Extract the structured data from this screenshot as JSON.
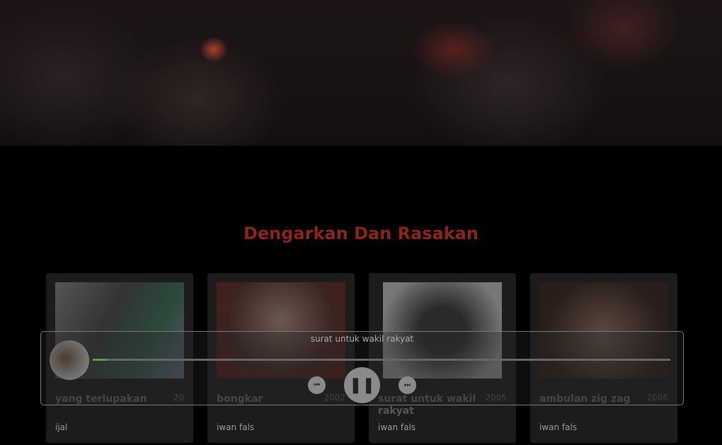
{
  "section_title": "Dengarkan Dan Rasakan",
  "cards": [
    {
      "title": "yang terlupakan",
      "year": "20",
      "artist": "ijal"
    },
    {
      "title": "bongkar",
      "year": "2002",
      "artist": "iwan fals"
    },
    {
      "title": "surat untuk wakil rakyat",
      "year": "2005",
      "artist": "iwan fals"
    },
    {
      "title": "ambulan zig zag",
      "year": "2006",
      "artist": "iwan fals"
    }
  ],
  "player": {
    "now_playing": "surat untuk wakil rakyat",
    "progress_percent": 2.5,
    "progress_color": "#5aa03a"
  }
}
